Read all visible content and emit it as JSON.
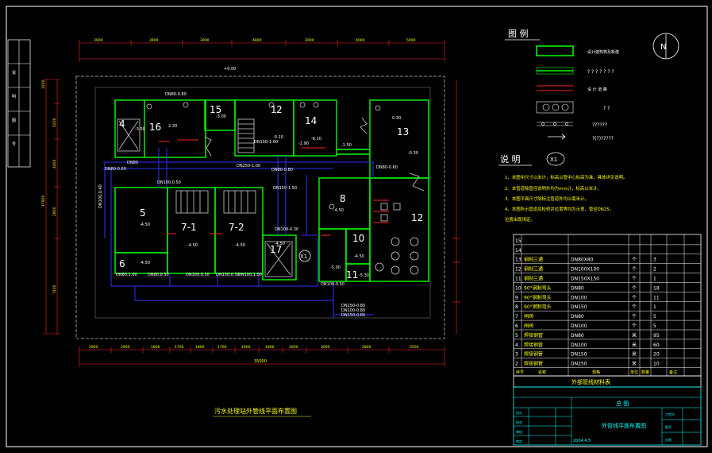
{
  "colors": {
    "background": "#000000",
    "frame": "#ffffff",
    "wall_green": "#00ff00",
    "pipe_blue": "#3030ff",
    "dimension_red": "#ff2020",
    "text_yellow": "#ffff00",
    "text_white": "#ffffff",
    "title_cyan": "#00ffff"
  },
  "titles": {
    "plan_title": "污水处理站外管线平面布置图",
    "material_table_title": "外部管线材料表"
  },
  "legend": {
    "header": "图 例",
    "items": [
      {
        "label": "设计建构筑及新建"
      },
      {
        "label": "? ? ? ? ? ? ?"
      },
      {
        "label": "设 计 道 路"
      },
      {
        "label": "? ?"
      },
      {
        "label": "??????"
      },
      {
        "label": "?(?)?????"
      }
    ]
  },
  "compass": {
    "label": "N"
  },
  "notes": {
    "header": "说 明",
    "symbol": "X1",
    "lines": [
      "1、本图中尺寸以米计，标高以管中心标高为准，具体详见说明。",
      "2、本管道除管径说明外均为mm计，标高以米计。",
      "3、本图平面尺寸除标注管道外均以毫米计。",
      "4、本图所示管道及检修井位置等均为示意，管径DN25，",
      "   位置由现场定。"
    ]
  },
  "rooms": [
    {
      "num": "1"
    },
    {
      "num": "2"
    },
    {
      "num": "4"
    },
    {
      "num": "5"
    },
    {
      "num": "6"
    },
    {
      "num": "7-1"
    },
    {
      "num": "7-2"
    },
    {
      "num": "8"
    },
    {
      "num": "10"
    },
    {
      "num": "11"
    },
    {
      "num": "12"
    },
    {
      "num": "13"
    },
    {
      "num": "14"
    },
    {
      "num": "15"
    },
    {
      "num": "16"
    },
    {
      "num": "17"
    },
    {
      "num": "X1"
    }
  ],
  "pipe_labels": [
    "DN80-0.80",
    "DN80",
    "DN100,0.50",
    "DN150-1.50",
    "DN80-0.80",
    "DN250-1.00",
    "DN100-0.50",
    "DN80,1.00",
    "DN80,0.50",
    "DN100,0.50",
    "DN150,0.50",
    "DN100,1.00",
    "DN150-0.80",
    "DN100-0.80",
    "DN150-0.80",
    "DN100-0.30",
    "DN80-0.60",
    "DN150-1.00",
    "DN80-0.60",
    "DN100,0.40"
  ],
  "elevations": [
    "-3.50",
    "-4.50",
    "-4.50",
    "-4.50",
    "-4.50",
    "-4.50",
    "-4.50",
    "-5.00",
    "-4.50",
    "-5.30",
    "0.30",
    "-2.90",
    "-6.10",
    "-0.10",
    "-3.00",
    "2.30",
    "-0.30",
    "-1.50",
    "+0.00"
  ],
  "top_dimensions": [
    "3000",
    "3900",
    "3000",
    "4800",
    "3000",
    "4000",
    "5000"
  ],
  "bottom_dimensions": [
    "2900",
    "2900",
    "1800",
    "1700",
    "1800",
    "1700",
    "1900",
    "1800",
    "1600",
    "3000",
    "2800",
    "3500"
  ],
  "bottom_total": "35000",
  "left_dimensions": [
    "3200",
    "5200",
    "4400",
    "2800",
    "7400",
    "17900"
  ],
  "material_table": {
    "columns": [
      "序号",
      "名称",
      "规格",
      "单位",
      "数量",
      "备注"
    ],
    "rows": [
      {
        "no": "15",
        "name": "",
        "spec": "",
        "unit": "",
        "qty": ""
      },
      {
        "no": "14",
        "name": "",
        "spec": "",
        "unit": "",
        "qty": ""
      },
      {
        "no": "13",
        "name": "钢制三通",
        "spec": "DN80X80",
        "unit": "个",
        "qty": "3"
      },
      {
        "no": "12",
        "name": "钢制三通",
        "spec": "DN100X100",
        "unit": "个",
        "qty": "2"
      },
      {
        "no": "11",
        "name": "钢制三通",
        "spec": "DN150X150",
        "unit": "个",
        "qty": "1"
      },
      {
        "no": "10",
        "name": "90°钢制弯头",
        "spec": "DN80",
        "unit": "个",
        "qty": "18"
      },
      {
        "no": "9",
        "name": "90°钢制弯头",
        "spec": "DN100",
        "unit": "个",
        "qty": "11"
      },
      {
        "no": "8",
        "name": "90°钢制弯头",
        "spec": "DN150",
        "unit": "个",
        "qty": "1"
      },
      {
        "no": "7",
        "name": "闸阀",
        "spec": "DN80",
        "unit": "个",
        "qty": "5"
      },
      {
        "no": "6",
        "name": "闸阀",
        "spec": "DN100",
        "unit": "个",
        "qty": "5"
      },
      {
        "no": "5",
        "name": "焊接钢管",
        "spec": "DN80",
        "unit": "米",
        "qty": "95"
      },
      {
        "no": "4",
        "name": "焊接钢管",
        "spec": "DN100",
        "unit": "米",
        "qty": "60"
      },
      {
        "no": "3",
        "name": "焊接钢管",
        "spec": "DN150",
        "unit": "米",
        "qty": "20"
      },
      {
        "no": "2",
        "name": "焊接钢管",
        "spec": "DN250",
        "unit": "米",
        "qty": "10"
      }
    ]
  },
  "title_block": {
    "drawing_name": "外管线平面布置图",
    "date": "2004.4.5",
    "cell_a": "总 图",
    "labels_left": [
      "设计",
      "校对",
      "审核",
      "审定"
    ],
    "labels_right": [
      "工程号",
      "图号",
      "比例"
    ]
  },
  "side_strip": [
    "说",
    "明",
    "图",
    "号"
  ]
}
